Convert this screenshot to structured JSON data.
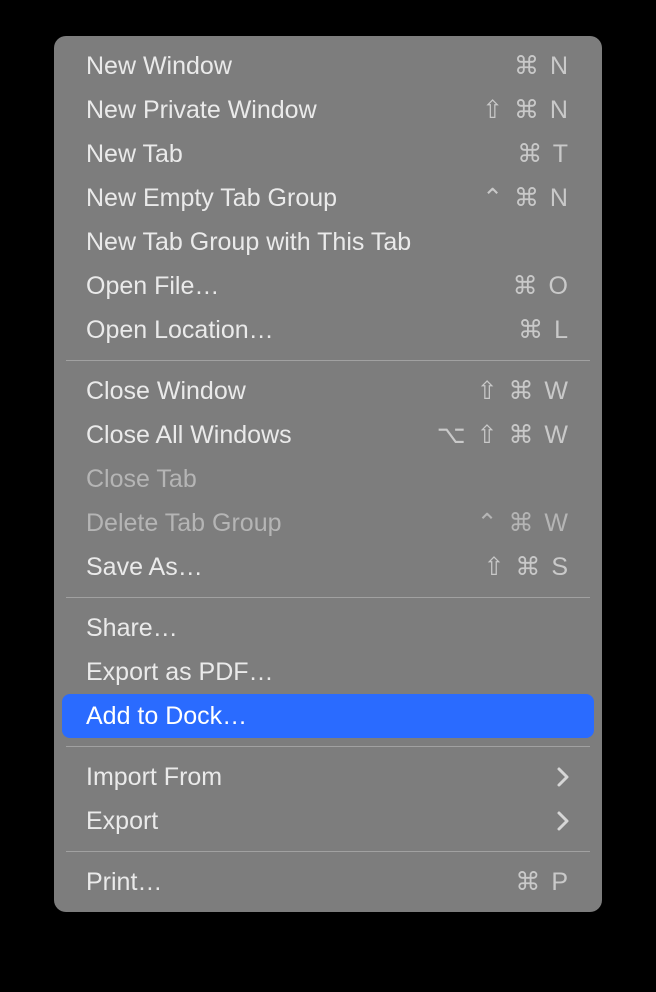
{
  "menu": {
    "groups": [
      [
        {
          "id": "new-window",
          "label": "New Window",
          "shortcut": "⌘ N",
          "disabled": false,
          "submenu": false
        },
        {
          "id": "new-private-window",
          "label": "New Private Window",
          "shortcut": "⇧ ⌘ N",
          "disabled": false,
          "submenu": false
        },
        {
          "id": "new-tab",
          "label": "New Tab",
          "shortcut": "⌘ T",
          "disabled": false,
          "submenu": false
        },
        {
          "id": "new-empty-tab-group",
          "label": "New Empty Tab Group",
          "shortcut": "⌃ ⌘ N",
          "disabled": false,
          "submenu": false
        },
        {
          "id": "new-tab-group-with-this-tab",
          "label": "New Tab Group with This Tab",
          "shortcut": "",
          "disabled": false,
          "submenu": false
        },
        {
          "id": "open-file",
          "label": "Open File…",
          "shortcut": "⌘ O",
          "disabled": false,
          "submenu": false
        },
        {
          "id": "open-location",
          "label": "Open Location…",
          "shortcut": "⌘ L",
          "disabled": false,
          "submenu": false
        }
      ],
      [
        {
          "id": "close-window",
          "label": "Close Window",
          "shortcut": "⇧ ⌘ W",
          "disabled": false,
          "submenu": false
        },
        {
          "id": "close-all-windows",
          "label": "Close All Windows",
          "shortcut": "⌥ ⇧ ⌘ W",
          "disabled": false,
          "submenu": false
        },
        {
          "id": "close-tab",
          "label": "Close Tab",
          "shortcut": "",
          "disabled": true,
          "submenu": false
        },
        {
          "id": "delete-tab-group",
          "label": "Delete Tab Group",
          "shortcut": "⌃ ⌘ W",
          "disabled": true,
          "submenu": false
        },
        {
          "id": "save-as",
          "label": "Save As…",
          "shortcut": "⇧ ⌘ S",
          "disabled": false,
          "submenu": false
        }
      ],
      [
        {
          "id": "share",
          "label": "Share…",
          "shortcut": "",
          "disabled": false,
          "submenu": false
        },
        {
          "id": "export-as-pdf",
          "label": "Export as PDF…",
          "shortcut": "",
          "disabled": false,
          "submenu": false
        },
        {
          "id": "add-to-dock",
          "label": "Add to Dock…",
          "shortcut": "",
          "disabled": false,
          "submenu": false,
          "selected": true
        }
      ],
      [
        {
          "id": "import-from",
          "label": "Import From",
          "shortcut": "",
          "disabled": false,
          "submenu": true
        },
        {
          "id": "export",
          "label": "Export",
          "shortcut": "",
          "disabled": false,
          "submenu": true
        }
      ],
      [
        {
          "id": "print",
          "label": "Print…",
          "shortcut": "⌘ P",
          "disabled": false,
          "submenu": false
        }
      ]
    ]
  }
}
